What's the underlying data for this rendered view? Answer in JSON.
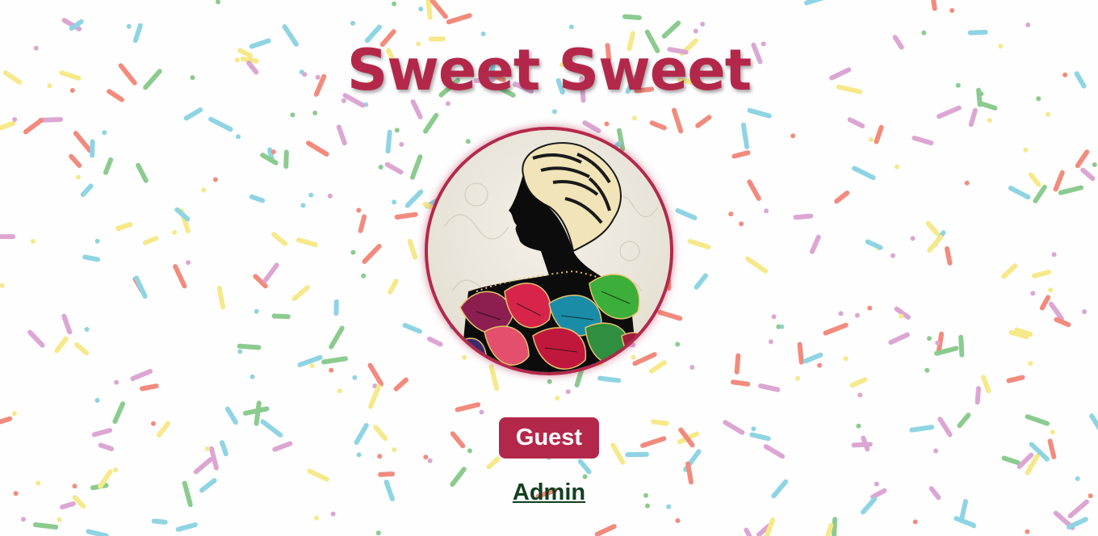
{
  "title": "Sweet Sweet",
  "avatar": {
    "description_icon": "woman-silhouette-with-butterflies-icon",
    "ring_color": "#b3284a"
  },
  "buttons": {
    "guest_label": "Guest"
  },
  "links": {
    "admin_label": "Admin"
  },
  "colors": {
    "brand": "#b3284a",
    "link": "#13401f",
    "sprinkles": [
      "#f28b7d",
      "#8fd4e3",
      "#8ccb8f",
      "#f5e98a",
      "#dca6d3"
    ]
  }
}
